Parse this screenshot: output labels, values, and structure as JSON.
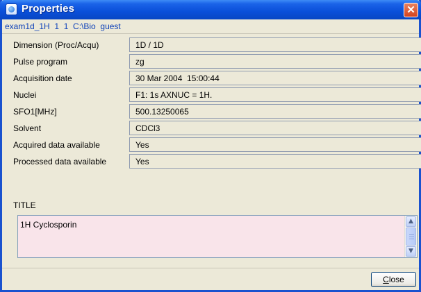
{
  "window": {
    "title": "Properties",
    "close_glyph": "✕"
  },
  "dataset_path": "exam1d_1H  1  1  C:\\Bio  guest",
  "properties": [
    {
      "label": "Dimension (Proc/Acqu)",
      "value": "1D / 1D"
    },
    {
      "label": "Pulse program",
      "value": "zg"
    },
    {
      "label": "Acquisition date",
      "value": "30 Mar 2004  15:00:44"
    },
    {
      "label": "Nuclei",
      "value": "F1: 1s AXNUC = 1H."
    },
    {
      "label": "SFO1[MHz]",
      "value": "500.13250065"
    },
    {
      "label": "Solvent",
      "value": "CDCl3"
    },
    {
      "label": "Acquired data available",
      "value": "Yes"
    },
    {
      "label": "Processed data available",
      "value": "Yes"
    }
  ],
  "title_section": {
    "label": "TITLE",
    "text": "1H Cyclosporin"
  },
  "buttons": {
    "close_mnemonic": "C",
    "close_rest": "lose"
  },
  "icons": {
    "app": "bruker-app-icon",
    "close": "close-icon",
    "scroll_up": "scroll-up-icon",
    "scroll_down": "scroll-down-icon"
  }
}
